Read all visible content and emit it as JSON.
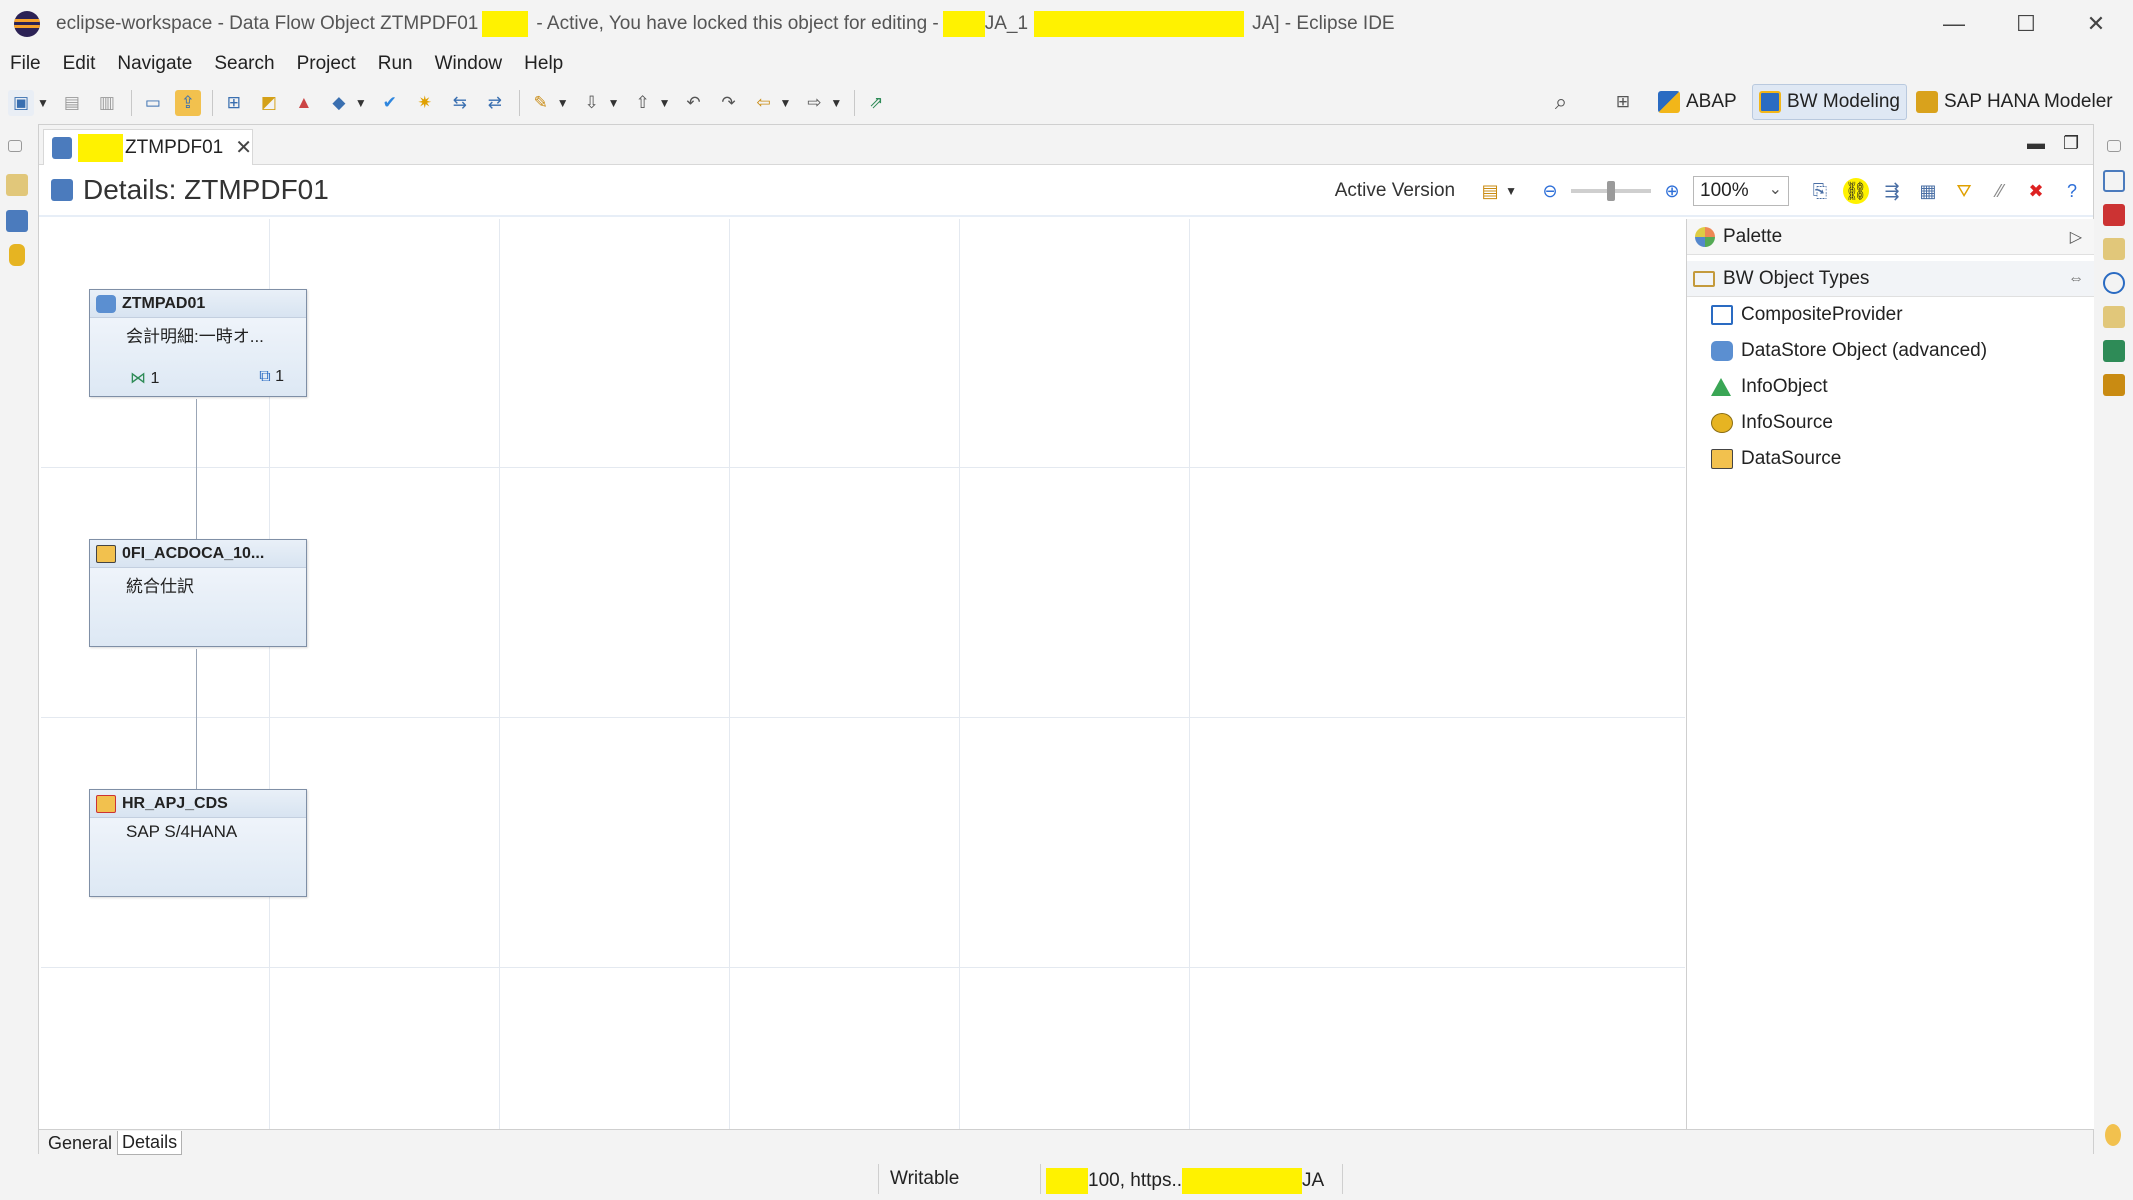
{
  "window": {
    "title_parts": [
      "eclipse-workspace - Data Flow Object ZTMPDF01",
      "- Active, You have locked this object for editing -",
      "JA_1",
      "JA] - Eclipse IDE"
    ],
    "minimize": "—",
    "maximize": "☐",
    "close": "✕"
  },
  "menu": [
    "File",
    "Edit",
    "Navigate",
    "Search",
    "Project",
    "Run",
    "Window",
    "Help"
  ],
  "perspectives": {
    "abap": "ABAP",
    "bw_modeling": "BW Modeling",
    "hana_modeler": "SAP HANA Modeler"
  },
  "editor": {
    "tab_label": "ZTMPDF01",
    "tab_close": "✕",
    "details_title": "Details: ZTMPDF01",
    "active_version_label": "Active Version",
    "zoom_value": "100%"
  },
  "nodes": [
    {
      "name": "ZTMPAD01",
      "description": "会計明細:一時オ...",
      "inbound_count": "1",
      "outbound_count": "1",
      "type": "datastore-object-advanced"
    },
    {
      "name": "0FI_ACDOCA_10...",
      "description": "統合仕訳",
      "type": "datasource"
    },
    {
      "name": "HR_APJ_CDS",
      "description": "SAP S/4HANA",
      "type": "source-system"
    }
  ],
  "palette": {
    "title": "Palette",
    "drawer": "BW Object Types",
    "items": [
      {
        "label": "CompositeProvider",
        "icon": "composite-provider-icon"
      },
      {
        "label": "DataStore Object (advanced)",
        "icon": "datastore-object-icon"
      },
      {
        "label": "InfoObject",
        "icon": "infoobject-icon"
      },
      {
        "label": "InfoSource",
        "icon": "infosource-icon"
      },
      {
        "label": "DataSource",
        "icon": "datasource-icon"
      }
    ]
  },
  "bottom_tabs": [
    "General",
    "Details"
  ],
  "status": {
    "writable": "Writable",
    "connection_prefix": "100, https..",
    "connection_suffix": "JA"
  },
  "colors": {
    "highlight": "#fff200",
    "accent": "#4b7bbd"
  }
}
